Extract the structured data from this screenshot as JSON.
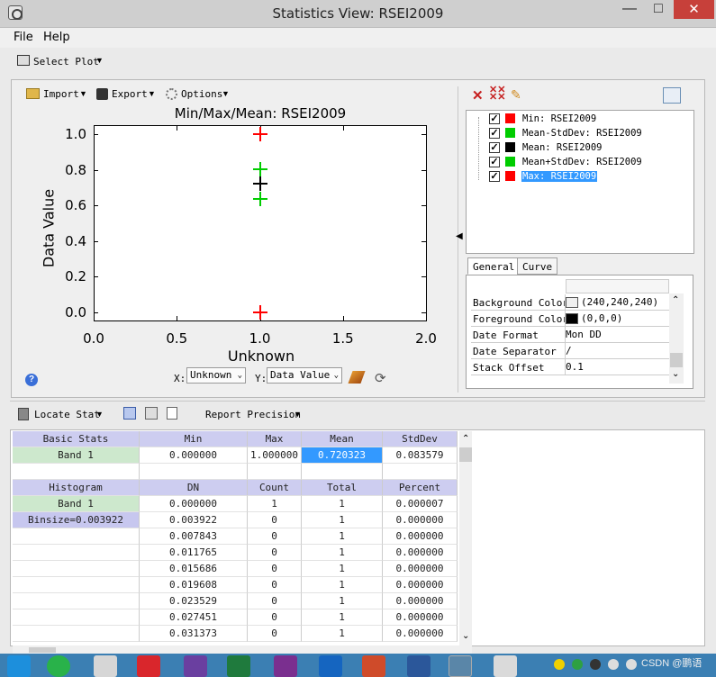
{
  "window": {
    "title": "Statistics View: RSEI2009",
    "minimize": "—",
    "maximize": "□",
    "close": "✕"
  },
  "menu": {
    "file": "File",
    "help": "Help"
  },
  "toolbar": {
    "select_plot": "Select Plot"
  },
  "plot_toolbar": {
    "import": "Import",
    "export": "Export",
    "options": "Options"
  },
  "chart_data": {
    "type": "scatter",
    "title": "Min/Max/Mean: RSEI2009",
    "xlabel": "Unknown",
    "ylabel": "Data Value",
    "xlim": [
      0.0,
      2.0
    ],
    "ylim": [
      0.0,
      1.0
    ],
    "x_ticks": [
      "0.0",
      "0.5",
      "1.0",
      "1.5",
      "2.0"
    ],
    "y_ticks": [
      "0.0",
      "0.2",
      "0.4",
      "0.6",
      "0.8",
      "1.0"
    ],
    "series": [
      {
        "name": "Min: RSEI2009",
        "color": "#ff0000",
        "x": [
          1.0
        ],
        "y": [
          0.0
        ]
      },
      {
        "name": "Mean-StdDev: RSEI2009",
        "color": "#00cc00",
        "x": [
          1.0
        ],
        "y": [
          0.636744
        ]
      },
      {
        "name": "Mean: RSEI2009",
        "color": "#000000",
        "x": [
          1.0
        ],
        "y": [
          0.720323
        ]
      },
      {
        "name": "Mean+StdDev: RSEI2009",
        "color": "#00cc00",
        "x": [
          1.0
        ],
        "y": [
          0.803902
        ]
      },
      {
        "name": "Max: RSEI2009",
        "color": "#ff0000",
        "x": [
          1.0
        ],
        "y": [
          1.0
        ]
      }
    ]
  },
  "axis_controls": {
    "x_label": "X:",
    "x_value": "Unknown",
    "y_label": "Y:",
    "y_value": "Data Value"
  },
  "legend": {
    "items": [
      {
        "label": "Min: RSEI2009",
        "color": "#ff0000",
        "checked": "✓"
      },
      {
        "label": "Mean-StdDev: RSEI2009",
        "color": "#00cc00",
        "checked": "✓"
      },
      {
        "label": "Mean: RSEI2009",
        "color": "#000000",
        "checked": "✓"
      },
      {
        "label": "Mean+StdDev: RSEI2009",
        "color": "#00cc00",
        "checked": "✓"
      },
      {
        "label": "Max: RSEI2009",
        "color": "#ff0000",
        "checked": "✓"
      }
    ]
  },
  "prop_tabs": {
    "general": "General",
    "curve": "Curve"
  },
  "properties": [
    {
      "key": "Background Color",
      "value": "(240,240,240)",
      "swatch": "#f0f0f0"
    },
    {
      "key": "Foreground Color",
      "value": "(0,0,0)",
      "swatch": "#000000"
    },
    {
      "key": "Date Format",
      "value": "Mon DD"
    },
    {
      "key": "Date Separator",
      "value": "/"
    },
    {
      "key": "Stack Offset",
      "value": "0.1"
    }
  ],
  "stats_toolbar": {
    "locate_stat": "Locate Stat",
    "report_precision": "Report Precision"
  },
  "basic_stats": {
    "headers": [
      "Basic Stats",
      "Min",
      "Max",
      "Mean",
      "StdDev"
    ],
    "row": [
      "Band 1",
      "0.000000",
      "1.000000",
      "0.720323",
      "0.083579"
    ]
  },
  "histogram": {
    "headers": [
      "Histogram",
      "DN",
      "Count",
      "Total",
      "Percent"
    ],
    "band": "Band 1",
    "binsize": "Binsize=0.003922",
    "rows": [
      [
        "0.000000",
        "1",
        "1",
        "0.000007"
      ],
      [
        "0.003922",
        "0",
        "1",
        "0.000000"
      ],
      [
        "0.007843",
        "0",
        "1",
        "0.000000"
      ],
      [
        "0.011765",
        "0",
        "1",
        "0.000000"
      ],
      [
        "0.015686",
        "0",
        "1",
        "0.000000"
      ],
      [
        "0.019608",
        "0",
        "1",
        "0.000000"
      ],
      [
        "0.023529",
        "0",
        "1",
        "0.000000"
      ],
      [
        "0.027451",
        "0",
        "1",
        "0.000000"
      ],
      [
        "0.031373",
        "0",
        "1",
        "0.000000"
      ]
    ]
  },
  "taskbar": {
    "tray_text": "CSDN @鹏语"
  }
}
